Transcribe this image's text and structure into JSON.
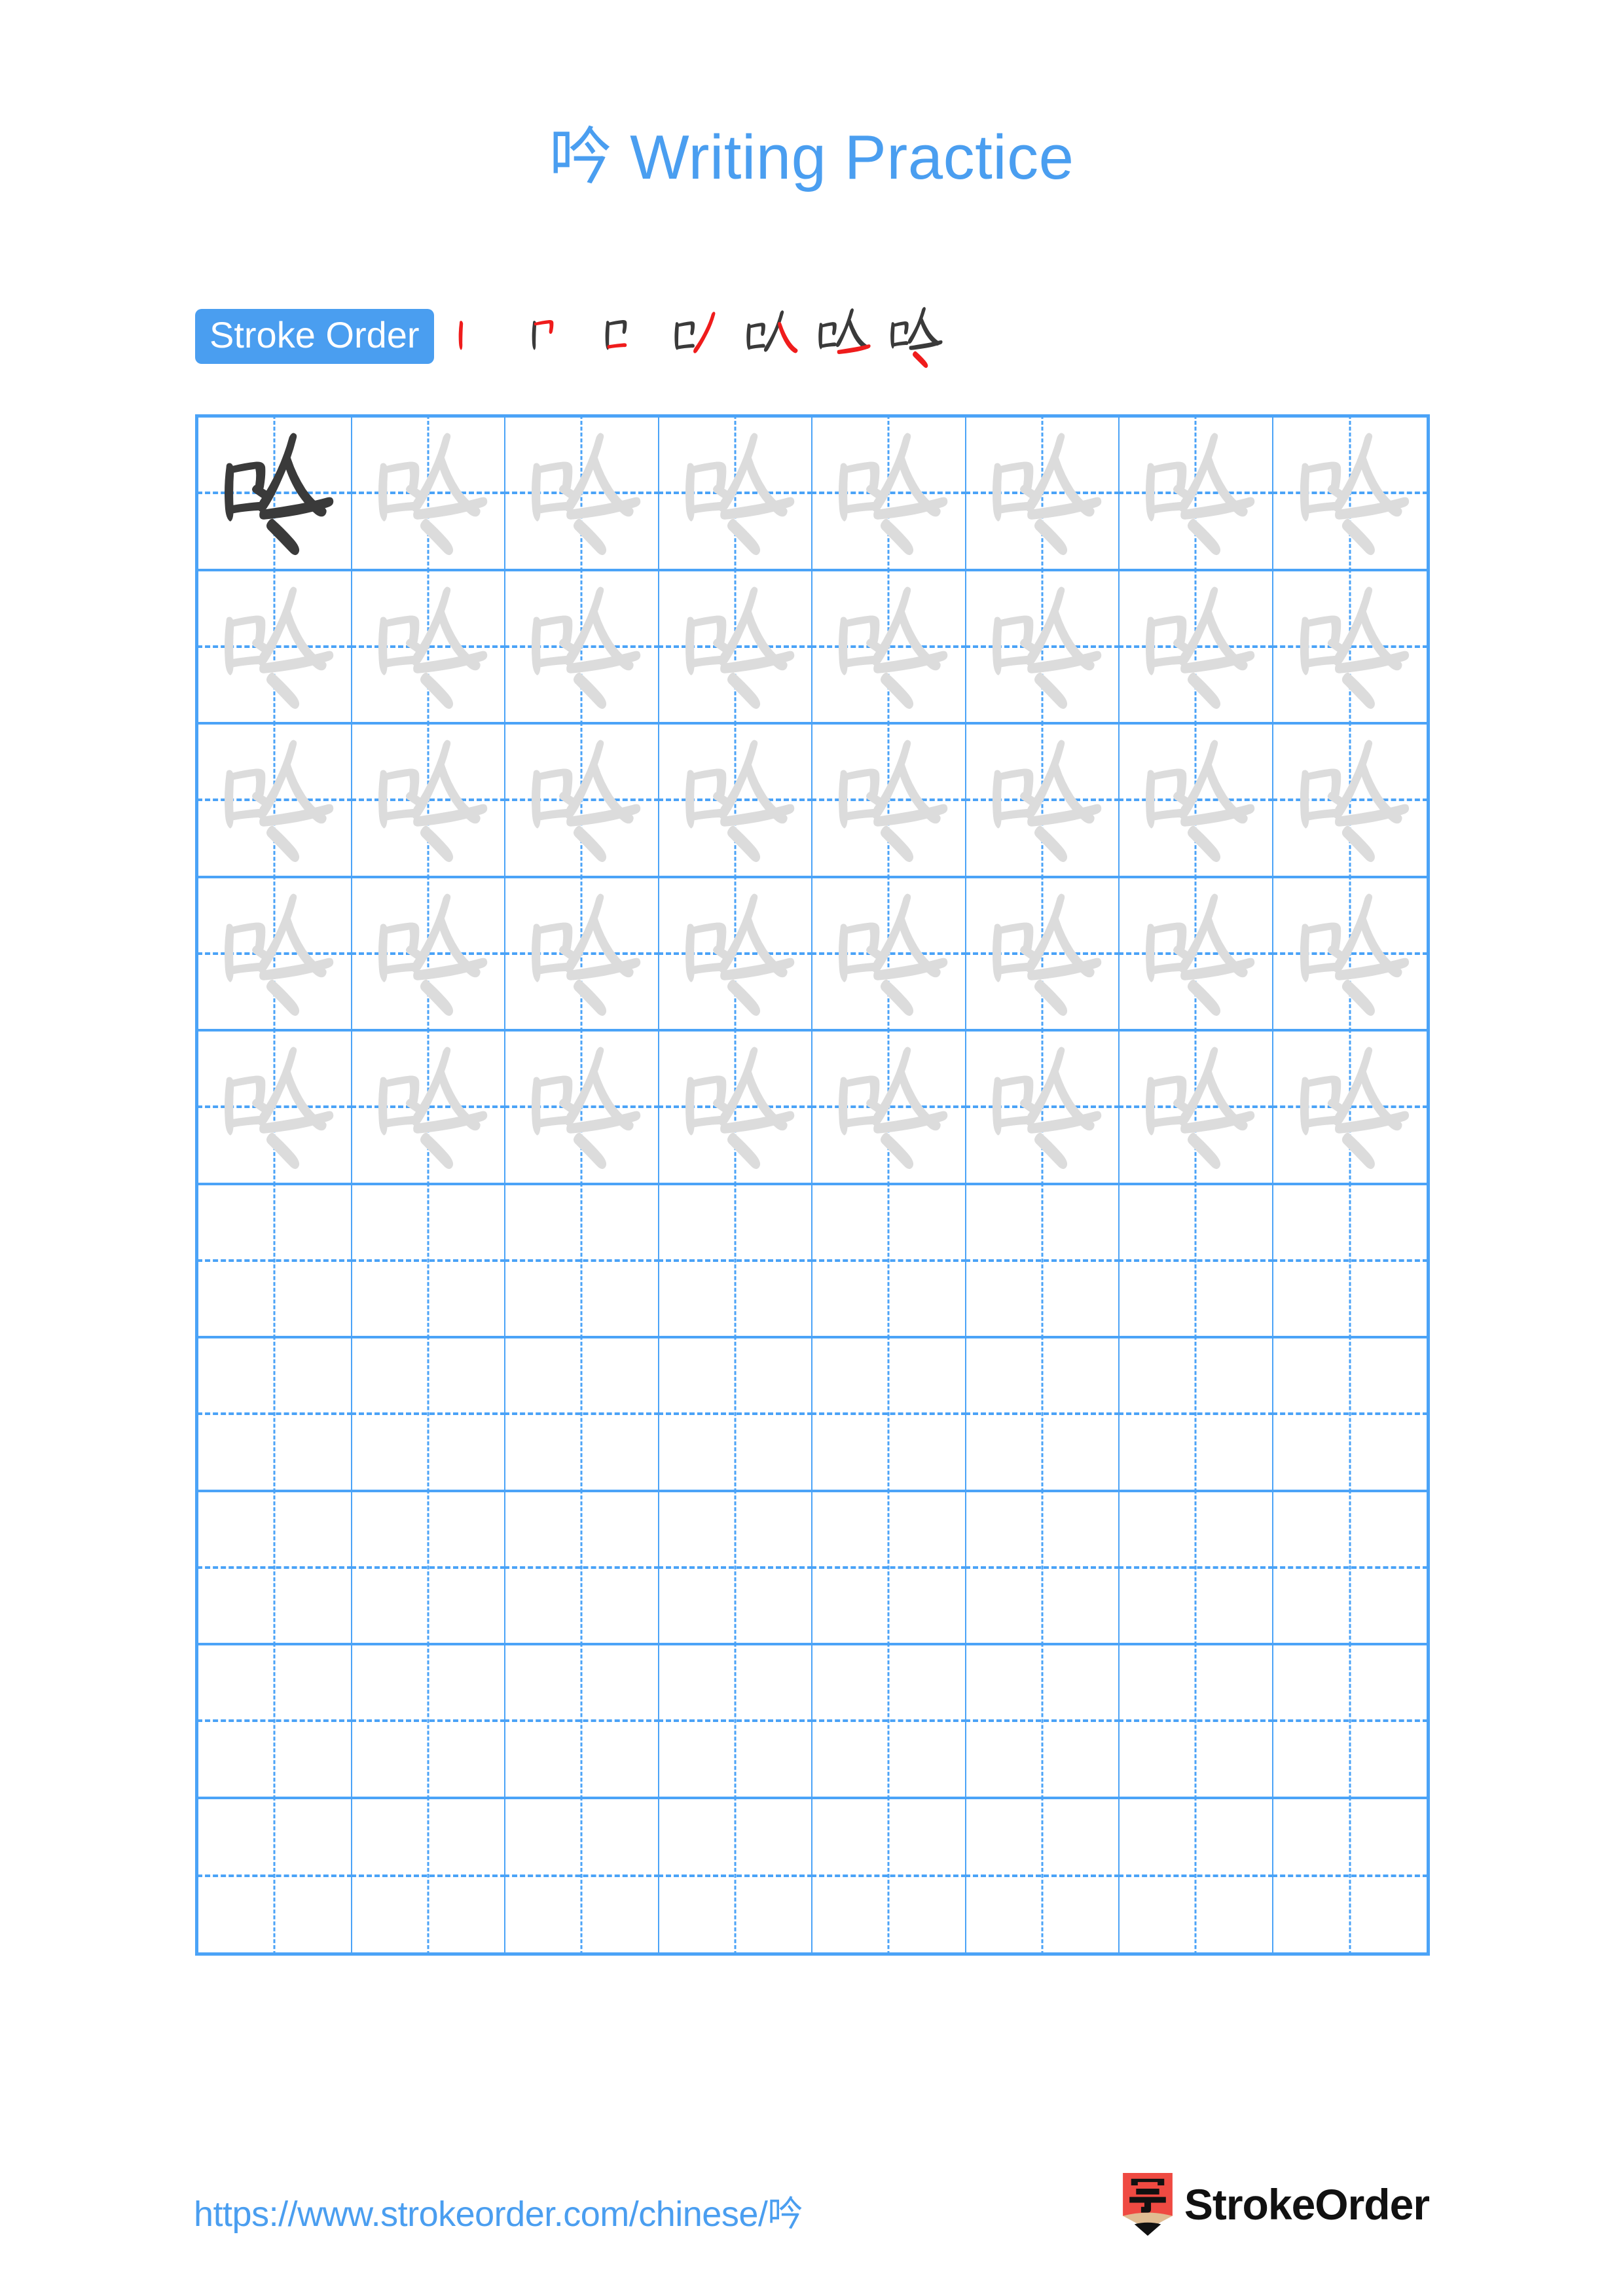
{
  "document": {
    "character": "吟",
    "title_suffix": "Writing Practice",
    "title_full": "吟 Writing Practice",
    "background_color": "#ffffff"
  },
  "colors": {
    "accent_blue": "#4a9ef0",
    "grid_blue": "#4ba3f7",
    "trace_gray": "#dcdcdc",
    "model_dark": "#3a3a3a",
    "stroke_new_red": "#ef1c1c",
    "stroke_old_dark": "#3a3a3a",
    "logo_red": "#ef4a42",
    "logo_wood": "#e0bc92",
    "logo_text": "#111111"
  },
  "stroke_order": {
    "badge_label": "Stroke Order",
    "total_strokes": 7,
    "steps": [
      {
        "index": 1,
        "strokes_shown": 1,
        "new_stroke_color": "#ef1c1c"
      },
      {
        "index": 2,
        "strokes_shown": 2,
        "new_stroke_color": "#ef1c1c"
      },
      {
        "index": 3,
        "strokes_shown": 3,
        "new_stroke_color": "#ef1c1c"
      },
      {
        "index": 4,
        "strokes_shown": 4,
        "new_stroke_color": "#ef1c1c"
      },
      {
        "index": 5,
        "strokes_shown": 5,
        "new_stroke_color": "#ef1c1c"
      },
      {
        "index": 6,
        "strokes_shown": 6,
        "new_stroke_color": "#ef1c1c"
      },
      {
        "index": 7,
        "strokes_shown": 7,
        "new_stroke_color": "#ef1c1c"
      }
    ]
  },
  "practice_grid": {
    "columns": 8,
    "rows": 10,
    "filled_rows": 5,
    "empty_rows": 5,
    "model_cell": {
      "row": 1,
      "col": 1,
      "style": "dark"
    },
    "guide_lines": "dashed-cross",
    "rows_data": [
      [
        "dark",
        "light",
        "light",
        "light",
        "light",
        "light",
        "light",
        "light"
      ],
      [
        "light",
        "light",
        "light",
        "light",
        "light",
        "light",
        "light",
        "light"
      ],
      [
        "light",
        "light",
        "light",
        "light",
        "light",
        "light",
        "light",
        "light"
      ],
      [
        "light",
        "light",
        "light",
        "light",
        "light",
        "light",
        "light",
        "light"
      ],
      [
        "light",
        "light",
        "light",
        "light",
        "light",
        "light",
        "light",
        "light"
      ],
      [
        "empty",
        "empty",
        "empty",
        "empty",
        "empty",
        "empty",
        "empty",
        "empty"
      ],
      [
        "empty",
        "empty",
        "empty",
        "empty",
        "empty",
        "empty",
        "empty",
        "empty"
      ],
      [
        "empty",
        "empty",
        "empty",
        "empty",
        "empty",
        "empty",
        "empty",
        "empty"
      ],
      [
        "empty",
        "empty",
        "empty",
        "empty",
        "empty",
        "empty",
        "empty",
        "empty"
      ],
      [
        "empty",
        "empty",
        "empty",
        "empty",
        "empty",
        "empty",
        "empty",
        "empty"
      ]
    ]
  },
  "footer": {
    "url": "https://www.strokeorder.com/chinese/吟",
    "brand_name": "StrokeOrder",
    "brand_icon_char": "字"
  }
}
